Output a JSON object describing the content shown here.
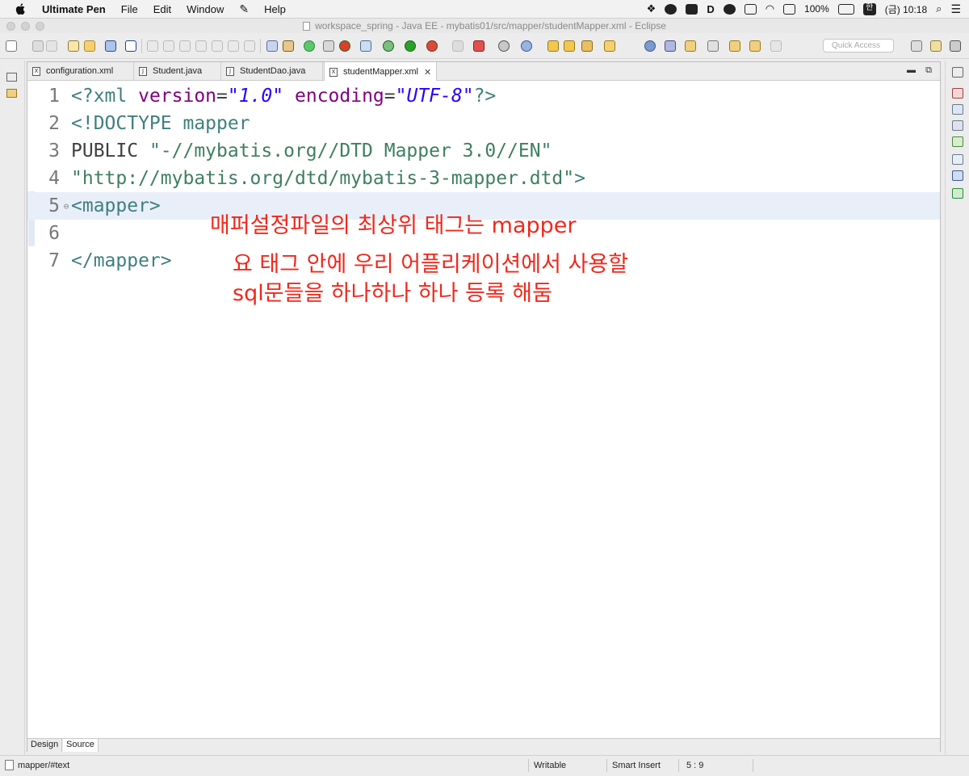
{
  "menubar": {
    "app_name": "Ultimate Pen",
    "items": [
      "File",
      "Edit",
      "Window",
      "Help"
    ],
    "battery": "100%",
    "input_method": "한",
    "clock": "(금) 10:18"
  },
  "window": {
    "title": "workspace_spring - Java EE - mybatis01/src/mapper/studentMapper.xml - Eclipse"
  },
  "toolbar": {
    "quick_access_placeholder": "Quick Access"
  },
  "editor": {
    "tabs": [
      {
        "label": "configuration.xml",
        "icon": "X",
        "active": false
      },
      {
        "label": "Student.java",
        "icon": "J",
        "active": false
      },
      {
        "label": "StudentDao.java",
        "icon": "J",
        "active": false
      },
      {
        "label": "studentMapper.xml",
        "icon": "X",
        "active": true
      }
    ],
    "lines": [
      {
        "num": "1",
        "parts": [
          {
            "t": "<?xml ",
            "c": "tag"
          },
          {
            "t": "version",
            "c": "attr"
          },
          {
            "t": "=",
            "c": "doc"
          },
          {
            "t": "\"1.0\"",
            "c": "val"
          },
          {
            "t": " ",
            "c": "doc"
          },
          {
            "t": "encoding",
            "c": "attr"
          },
          {
            "t": "=",
            "c": "doc"
          },
          {
            "t": "\"UTF-8\"",
            "c": "val"
          },
          {
            "t": "?>",
            "c": "tag"
          }
        ]
      },
      {
        "num": "2",
        "parts": [
          {
            "t": "<!DOCTYPE ",
            "c": "tag"
          },
          {
            "t": "mapper",
            "c": "tag"
          }
        ]
      },
      {
        "num": "3",
        "parts": [
          {
            "t": "PUBLIC ",
            "c": "doc"
          },
          {
            "t": "\"-//mybatis.org//DTD Mapper 3.0//EN\"",
            "c": "str"
          }
        ]
      },
      {
        "num": "4",
        "parts": [
          {
            "t": "\"http://mybatis.org/dtd/mybatis-3-mapper.dtd\"",
            "c": "str"
          },
          {
            "t": ">",
            "c": "tag"
          }
        ]
      },
      {
        "num": "5",
        "fold": "⊖",
        "current": true,
        "parts": [
          {
            "t": "<mapper>",
            "c": "tag"
          }
        ]
      },
      {
        "num": "6",
        "parts": []
      },
      {
        "num": "7",
        "parts": [
          {
            "t": "</mapper>",
            "c": "tag"
          }
        ]
      }
    ],
    "bottom_tabs": [
      "Design",
      "Source"
    ]
  },
  "annotations": {
    "line1": "매퍼설정파일의 최상위 태그는 mapper",
    "line2": "요 태그 안에 우리 어플리케이션에서 사용할",
    "line3": "sql문들을 하나하나 하나 등록 해둠"
  },
  "statusbar": {
    "path": "mapper/#text",
    "writable": "Writable",
    "insert_mode": "Smart Insert",
    "position": "5 : 9"
  },
  "colors": {
    "annotation": "#f0281c",
    "xml_tag": "#3f7f7f",
    "xml_attr": "#7f007f",
    "xml_value": "#2a00ff",
    "xml_string": "#3f7f5f"
  }
}
